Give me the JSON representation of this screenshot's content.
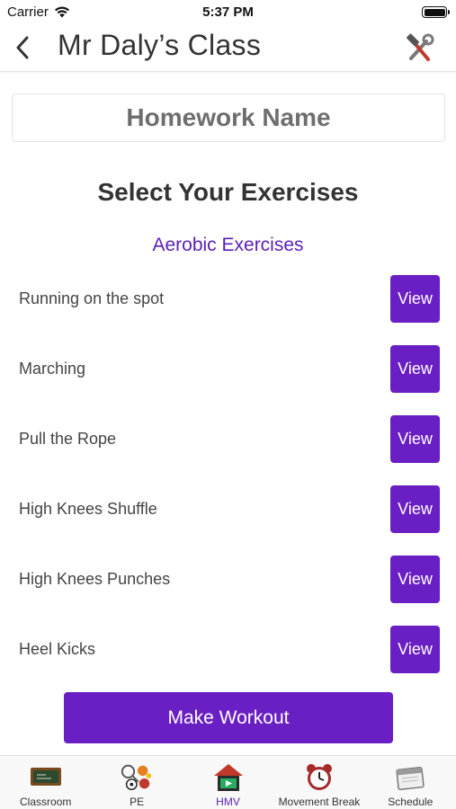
{
  "status_bar": {
    "carrier": "Carrier",
    "time": "5:37 PM"
  },
  "nav": {
    "title": "Mr Daly’s Class",
    "back_icon": "chevron-left-icon",
    "tools_icon": "hammer-wrench-icon"
  },
  "homework": {
    "placeholder": "Homework Name",
    "value": ""
  },
  "main": {
    "section_title": "Select Your Exercises",
    "category_title": "Aerobic Exercises",
    "exercises": [
      {
        "label": "Running on the spot",
        "button": "View"
      },
      {
        "label": "Marching",
        "button": "View"
      },
      {
        "label": "Pull the Rope",
        "button": "View"
      },
      {
        "label": "High Knees Shuffle",
        "button": "View"
      },
      {
        "label": "High Knees Punches",
        "button": "View"
      },
      {
        "label": "Heel Kicks",
        "button": "View"
      }
    ],
    "make_workout_label": "Make Workout"
  },
  "tab_bar": {
    "tabs": [
      {
        "label": "Classroom",
        "icon": "chalkboard-icon"
      },
      {
        "label": "PE",
        "icon": "sports-balls-icon"
      },
      {
        "label": "HMV",
        "icon": "house-film-icon",
        "active": true
      },
      {
        "label": "Movement Break",
        "icon": "alarm-clock-icon"
      },
      {
        "label": "Schedule",
        "icon": "calendar-icon"
      }
    ]
  },
  "colors": {
    "accent": "#6a1fc4",
    "category_text": "#5a1fb8",
    "text_dark": "#333333"
  }
}
